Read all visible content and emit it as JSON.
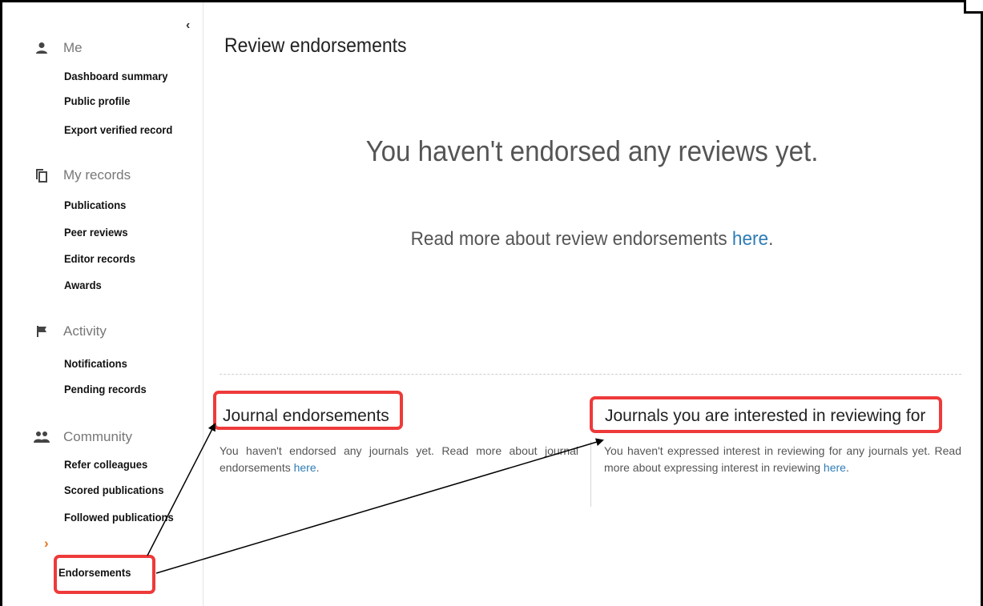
{
  "sidebar": {
    "collapse_glyph": "‹",
    "me": {
      "label": "Me",
      "icon": "person-icon",
      "items": [
        {
          "label": "Dashboard summary"
        },
        {
          "label": "Public profile"
        },
        {
          "label": "Export verified record"
        }
      ]
    },
    "records": {
      "label": "My records",
      "icon": "copy-icon",
      "items": [
        {
          "label": "Publications"
        },
        {
          "label": "Peer reviews"
        },
        {
          "label": "Editor records"
        },
        {
          "label": "Awards"
        }
      ]
    },
    "activity": {
      "label": "Activity",
      "icon": "flag-icon",
      "items": [
        {
          "label": "Notifications"
        },
        {
          "label": "Pending records"
        }
      ]
    },
    "community": {
      "label": "Community",
      "icon": "group-icon",
      "items": [
        {
          "label": "Refer colleagues"
        },
        {
          "label": "Scored publications"
        },
        {
          "label": "Followed publications"
        },
        {
          "label": "Endorsements"
        }
      ]
    },
    "active_caret": "›",
    "active_color": "#e8731b"
  },
  "main": {
    "title": "Review endorsements",
    "empty_message": "You haven't endorsed any reviews yet.",
    "readmore_text": "Read more about review endorsements ",
    "readmore_link": "here",
    "readmore_suffix": "."
  },
  "journal_endorsements": {
    "heading": "Journal endorsements",
    "text": "You haven't endorsed any journals yet. Read more about journal endorsements ",
    "link": "here",
    "suffix": "."
  },
  "journals_interested": {
    "heading": "Journals you are interested in reviewing for",
    "text": "You haven't expressed interest in reviewing for any journals yet. Read more about expressing interest in reviewing ",
    "link": "here",
    "suffix": "."
  },
  "annotation": {
    "highlight_color": "#ee3a3a",
    "arrow_color": "#000000"
  },
  "colors": {
    "link": "#2e7cb5",
    "accent": "#e8731b"
  }
}
